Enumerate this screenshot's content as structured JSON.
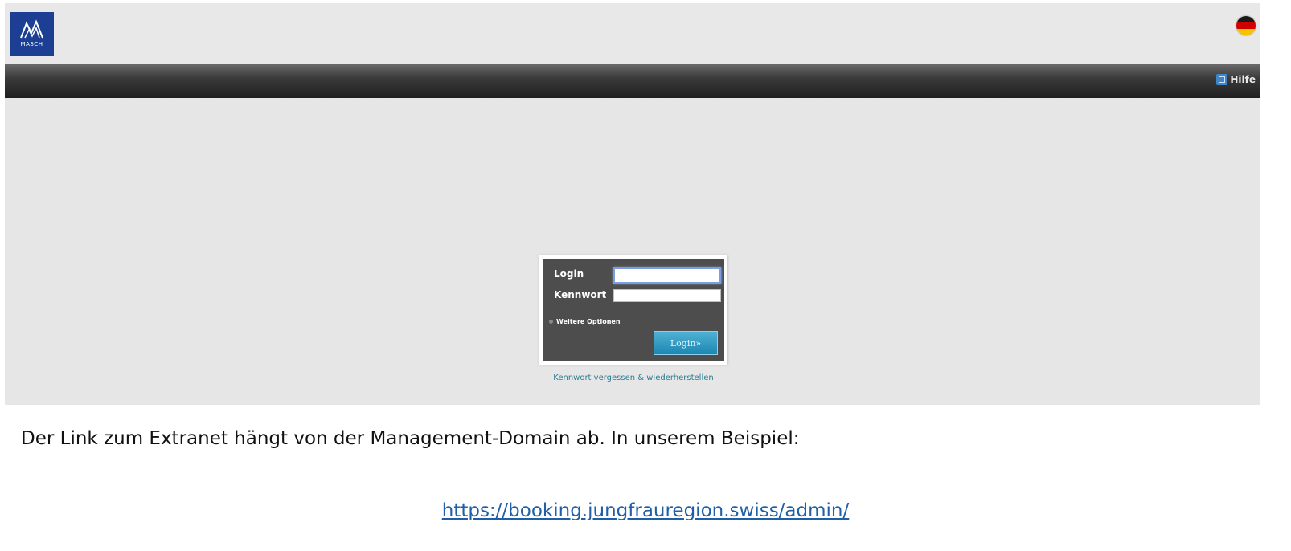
{
  "header": {
    "logo_text": "MASCH",
    "language_flag": "de-flag-icon"
  },
  "navbar": {
    "help_label": "Hilfe",
    "help_icon": "help-icon"
  },
  "login_form": {
    "login_label": "Login",
    "login_value": "",
    "password_label": "Kennwort",
    "password_value": "",
    "more_options_label": "Weitere Optionen",
    "submit_label": "Login»",
    "forgot_link": "Kennwort vergessen & wiederherstellen"
  },
  "caption": {
    "text": "Der Link zum Extranet hängt von der Management-Domain ab. In unserem Beispiel:",
    "url": "https://booking.jungfrauregion.swiss/admin/"
  },
  "colors": {
    "logo_bg": "#1d3f93",
    "navbar_dark": "#1f1f1f",
    "login_button": "#1e86b3",
    "link": "#2b7e96"
  }
}
